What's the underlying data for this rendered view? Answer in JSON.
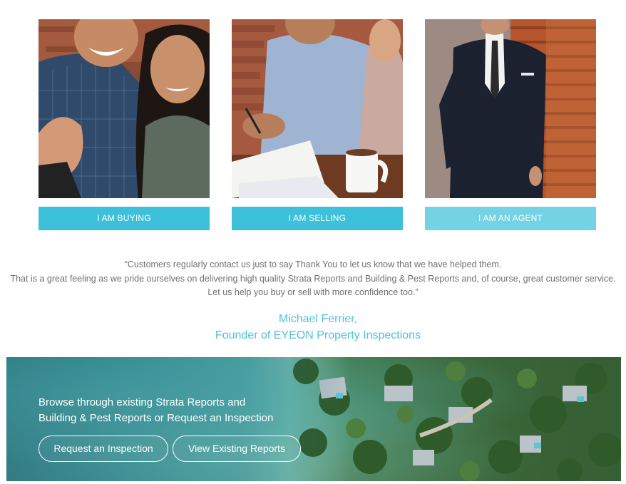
{
  "colors": {
    "button_primary": "#3dc1db",
    "button_light": "#73d2e3",
    "accent_text": "#4cc3dd",
    "body_text": "#707070"
  },
  "cards": [
    {
      "label": "I AM BUYING",
      "image": "smiling couple at property handshake photo"
    },
    {
      "label": "I AM SELLING",
      "image": "couple signing documents with coffee mug photo"
    },
    {
      "label": "I AM AN AGENT",
      "image": "agent in suit leaning on timber wall photo"
    }
  ],
  "quote": {
    "line1": "“Customers regularly contact us just to say Thank You to let us know that we have helped them.",
    "line2": "That is a great feeling as we pride ourselves on delivering high quality Strata Reports and Building & Pest Reports and, of course, great customer service.",
    "line3": "Let us help you buy or sell with more confidence too.”"
  },
  "author": {
    "name": "Michael Ferrier,",
    "title": "Founder of EYEON Property Inspections"
  },
  "banner": {
    "tagline_line1": "Browse through existing Strata Reports and",
    "tagline_line2": "Building & Pest Reports or Request an Inspection",
    "request_button": "Request an Inspection",
    "view_button": "View Existing Reports",
    "image": "aerial coastal suburb photo"
  }
}
